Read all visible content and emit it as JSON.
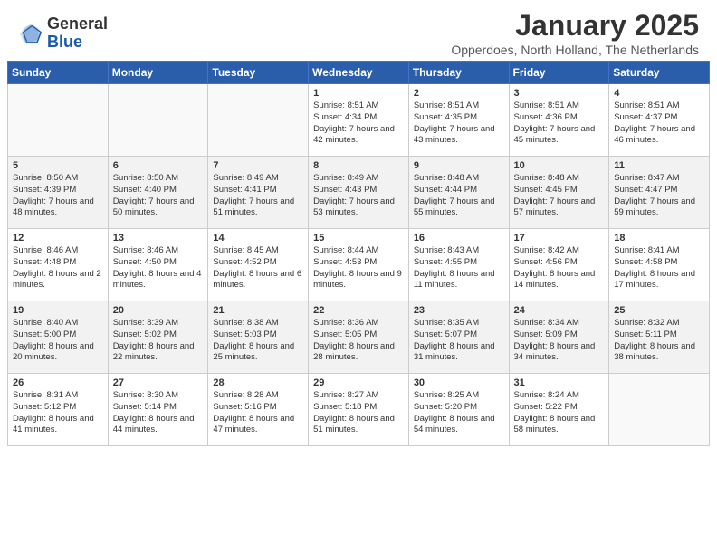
{
  "header": {
    "logo_general": "General",
    "logo_blue": "Blue",
    "month_title": "January 2025",
    "location": "Opperdoes, North Holland, The Netherlands"
  },
  "weekdays": [
    "Sunday",
    "Monday",
    "Tuesday",
    "Wednesday",
    "Thursday",
    "Friday",
    "Saturday"
  ],
  "weeks": [
    [
      {
        "day": "",
        "info": ""
      },
      {
        "day": "",
        "info": ""
      },
      {
        "day": "",
        "info": ""
      },
      {
        "day": "1",
        "info": "Sunrise: 8:51 AM\nSunset: 4:34 PM\nDaylight: 7 hours and 42 minutes."
      },
      {
        "day": "2",
        "info": "Sunrise: 8:51 AM\nSunset: 4:35 PM\nDaylight: 7 hours and 43 minutes."
      },
      {
        "day": "3",
        "info": "Sunrise: 8:51 AM\nSunset: 4:36 PM\nDaylight: 7 hours and 45 minutes."
      },
      {
        "day": "4",
        "info": "Sunrise: 8:51 AM\nSunset: 4:37 PM\nDaylight: 7 hours and 46 minutes."
      }
    ],
    [
      {
        "day": "5",
        "info": "Sunrise: 8:50 AM\nSunset: 4:39 PM\nDaylight: 7 hours and 48 minutes."
      },
      {
        "day": "6",
        "info": "Sunrise: 8:50 AM\nSunset: 4:40 PM\nDaylight: 7 hours and 50 minutes."
      },
      {
        "day": "7",
        "info": "Sunrise: 8:49 AM\nSunset: 4:41 PM\nDaylight: 7 hours and 51 minutes."
      },
      {
        "day": "8",
        "info": "Sunrise: 8:49 AM\nSunset: 4:43 PM\nDaylight: 7 hours and 53 minutes."
      },
      {
        "day": "9",
        "info": "Sunrise: 8:48 AM\nSunset: 4:44 PM\nDaylight: 7 hours and 55 minutes."
      },
      {
        "day": "10",
        "info": "Sunrise: 8:48 AM\nSunset: 4:45 PM\nDaylight: 7 hours and 57 minutes."
      },
      {
        "day": "11",
        "info": "Sunrise: 8:47 AM\nSunset: 4:47 PM\nDaylight: 7 hours and 59 minutes."
      }
    ],
    [
      {
        "day": "12",
        "info": "Sunrise: 8:46 AM\nSunset: 4:48 PM\nDaylight: 8 hours and 2 minutes."
      },
      {
        "day": "13",
        "info": "Sunrise: 8:46 AM\nSunset: 4:50 PM\nDaylight: 8 hours and 4 minutes."
      },
      {
        "day": "14",
        "info": "Sunrise: 8:45 AM\nSunset: 4:52 PM\nDaylight: 8 hours and 6 minutes."
      },
      {
        "day": "15",
        "info": "Sunrise: 8:44 AM\nSunset: 4:53 PM\nDaylight: 8 hours and 9 minutes."
      },
      {
        "day": "16",
        "info": "Sunrise: 8:43 AM\nSunset: 4:55 PM\nDaylight: 8 hours and 11 minutes."
      },
      {
        "day": "17",
        "info": "Sunrise: 8:42 AM\nSunset: 4:56 PM\nDaylight: 8 hours and 14 minutes."
      },
      {
        "day": "18",
        "info": "Sunrise: 8:41 AM\nSunset: 4:58 PM\nDaylight: 8 hours and 17 minutes."
      }
    ],
    [
      {
        "day": "19",
        "info": "Sunrise: 8:40 AM\nSunset: 5:00 PM\nDaylight: 8 hours and 20 minutes."
      },
      {
        "day": "20",
        "info": "Sunrise: 8:39 AM\nSunset: 5:02 PM\nDaylight: 8 hours and 22 minutes."
      },
      {
        "day": "21",
        "info": "Sunrise: 8:38 AM\nSunset: 5:03 PM\nDaylight: 8 hours and 25 minutes."
      },
      {
        "day": "22",
        "info": "Sunrise: 8:36 AM\nSunset: 5:05 PM\nDaylight: 8 hours and 28 minutes."
      },
      {
        "day": "23",
        "info": "Sunrise: 8:35 AM\nSunset: 5:07 PM\nDaylight: 8 hours and 31 minutes."
      },
      {
        "day": "24",
        "info": "Sunrise: 8:34 AM\nSunset: 5:09 PM\nDaylight: 8 hours and 34 minutes."
      },
      {
        "day": "25",
        "info": "Sunrise: 8:32 AM\nSunset: 5:11 PM\nDaylight: 8 hours and 38 minutes."
      }
    ],
    [
      {
        "day": "26",
        "info": "Sunrise: 8:31 AM\nSunset: 5:12 PM\nDaylight: 8 hours and 41 minutes."
      },
      {
        "day": "27",
        "info": "Sunrise: 8:30 AM\nSunset: 5:14 PM\nDaylight: 8 hours and 44 minutes."
      },
      {
        "day": "28",
        "info": "Sunrise: 8:28 AM\nSunset: 5:16 PM\nDaylight: 8 hours and 47 minutes."
      },
      {
        "day": "29",
        "info": "Sunrise: 8:27 AM\nSunset: 5:18 PM\nDaylight: 8 hours and 51 minutes."
      },
      {
        "day": "30",
        "info": "Sunrise: 8:25 AM\nSunset: 5:20 PM\nDaylight: 8 hours and 54 minutes."
      },
      {
        "day": "31",
        "info": "Sunrise: 8:24 AM\nSunset: 5:22 PM\nDaylight: 8 hours and 58 minutes."
      },
      {
        "day": "",
        "info": ""
      }
    ]
  ]
}
